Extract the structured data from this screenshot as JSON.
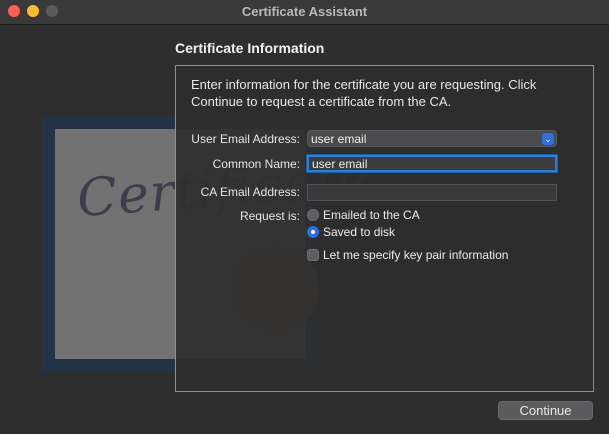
{
  "window": {
    "title": "Certificate Assistant"
  },
  "illustration": {
    "word": "Certificate"
  },
  "section": {
    "title": "Certificate Information"
  },
  "intro": "Enter information for the certificate you are requesting. Click Continue to request a certificate from the CA.",
  "form": {
    "user_email_label": "User Email Address:",
    "user_email_value": "user email",
    "common_name_label": "Common Name:",
    "common_name_value": "user email",
    "ca_email_label": "CA Email Address:",
    "ca_email_value": "",
    "request_label": "Request is:",
    "request_options": [
      "Emailed to the CA",
      "Saved to disk"
    ],
    "request_selected": "Saved to disk",
    "keypair_label": "Let me specify key pair information",
    "keypair_checked": false
  },
  "buttons": {
    "continue": "Continue"
  },
  "colors": {
    "accent": "#2b6fe0",
    "focus_ring": "#2c7fd8"
  },
  "icons": {
    "popup": "chevron-updown-icon"
  }
}
